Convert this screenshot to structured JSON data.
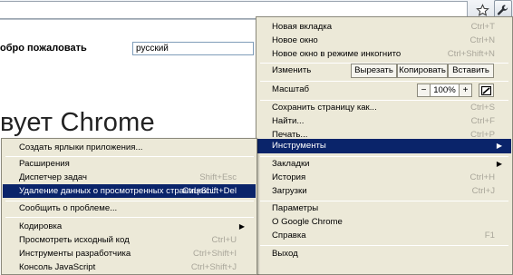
{
  "toolbar": {
    "star_icon": "star-icon",
    "wrench_icon": "wrench-icon"
  },
  "page": {
    "welcome": "обро пожаловать",
    "language_value": "русский",
    "headline": "вует Chrome"
  },
  "menu": {
    "new_tab": {
      "label": "Новая вкладка",
      "shortcut": "Ctrl+T"
    },
    "new_window": {
      "label": "Новое окно",
      "shortcut": "Ctrl+N"
    },
    "incognito": {
      "label": "Новое окно в режиме инкогнито",
      "shortcut": "Ctrl+Shift+N"
    },
    "edit": {
      "label": "Изменить",
      "cut": "Вырезать",
      "copy": "Копировать",
      "paste": "Вставить"
    },
    "zoom": {
      "label": "Масштаб",
      "minus": "−",
      "value": "100%",
      "plus": "+"
    },
    "save_page": {
      "label": "Сохранить страницу как...",
      "shortcut": "Ctrl+S"
    },
    "find": {
      "label": "Найти...",
      "shortcut": "Ctrl+F"
    },
    "print": {
      "label": "Печать...",
      "shortcut": "Ctrl+P"
    },
    "tools": {
      "label": "Инструменты"
    },
    "bookmarks": {
      "label": "Закладки"
    },
    "history": {
      "label": "История",
      "shortcut": "Ctrl+H"
    },
    "downloads": {
      "label": "Загрузки",
      "shortcut": "Ctrl+J"
    },
    "settings": {
      "label": "Параметры"
    },
    "about": {
      "label": "О Google Chrome"
    },
    "help": {
      "label": "Справка",
      "shortcut": "F1"
    },
    "exit": {
      "label": "Выход"
    }
  },
  "submenu": {
    "create_shortcuts": {
      "label": "Создать ярлыки приложения..."
    },
    "extensions": {
      "label": "Расширения"
    },
    "task_manager": {
      "label": "Диспетчер задач",
      "shortcut": "Shift+Esc"
    },
    "clear_data": {
      "label": "Удаление данных о просмотренных страницах...",
      "shortcut": "Ctrl+Shift+Del"
    },
    "report_issue": {
      "label": "Сообщить о проблеме..."
    },
    "encoding": {
      "label": "Кодировка"
    },
    "view_source": {
      "label": "Просмотреть исходный код",
      "shortcut": "Ctrl+U"
    },
    "dev_tools": {
      "label": "Инструменты разработчика",
      "shortcut": "Ctrl+Shift+I"
    },
    "js_console": {
      "label": "Консоль JavaScript",
      "shortcut": "Ctrl+Shift+J"
    }
  },
  "colors": {
    "highlight": "#0a246a",
    "menu_bg": "#ece9d8",
    "disabled_text": "#a9a69a"
  }
}
